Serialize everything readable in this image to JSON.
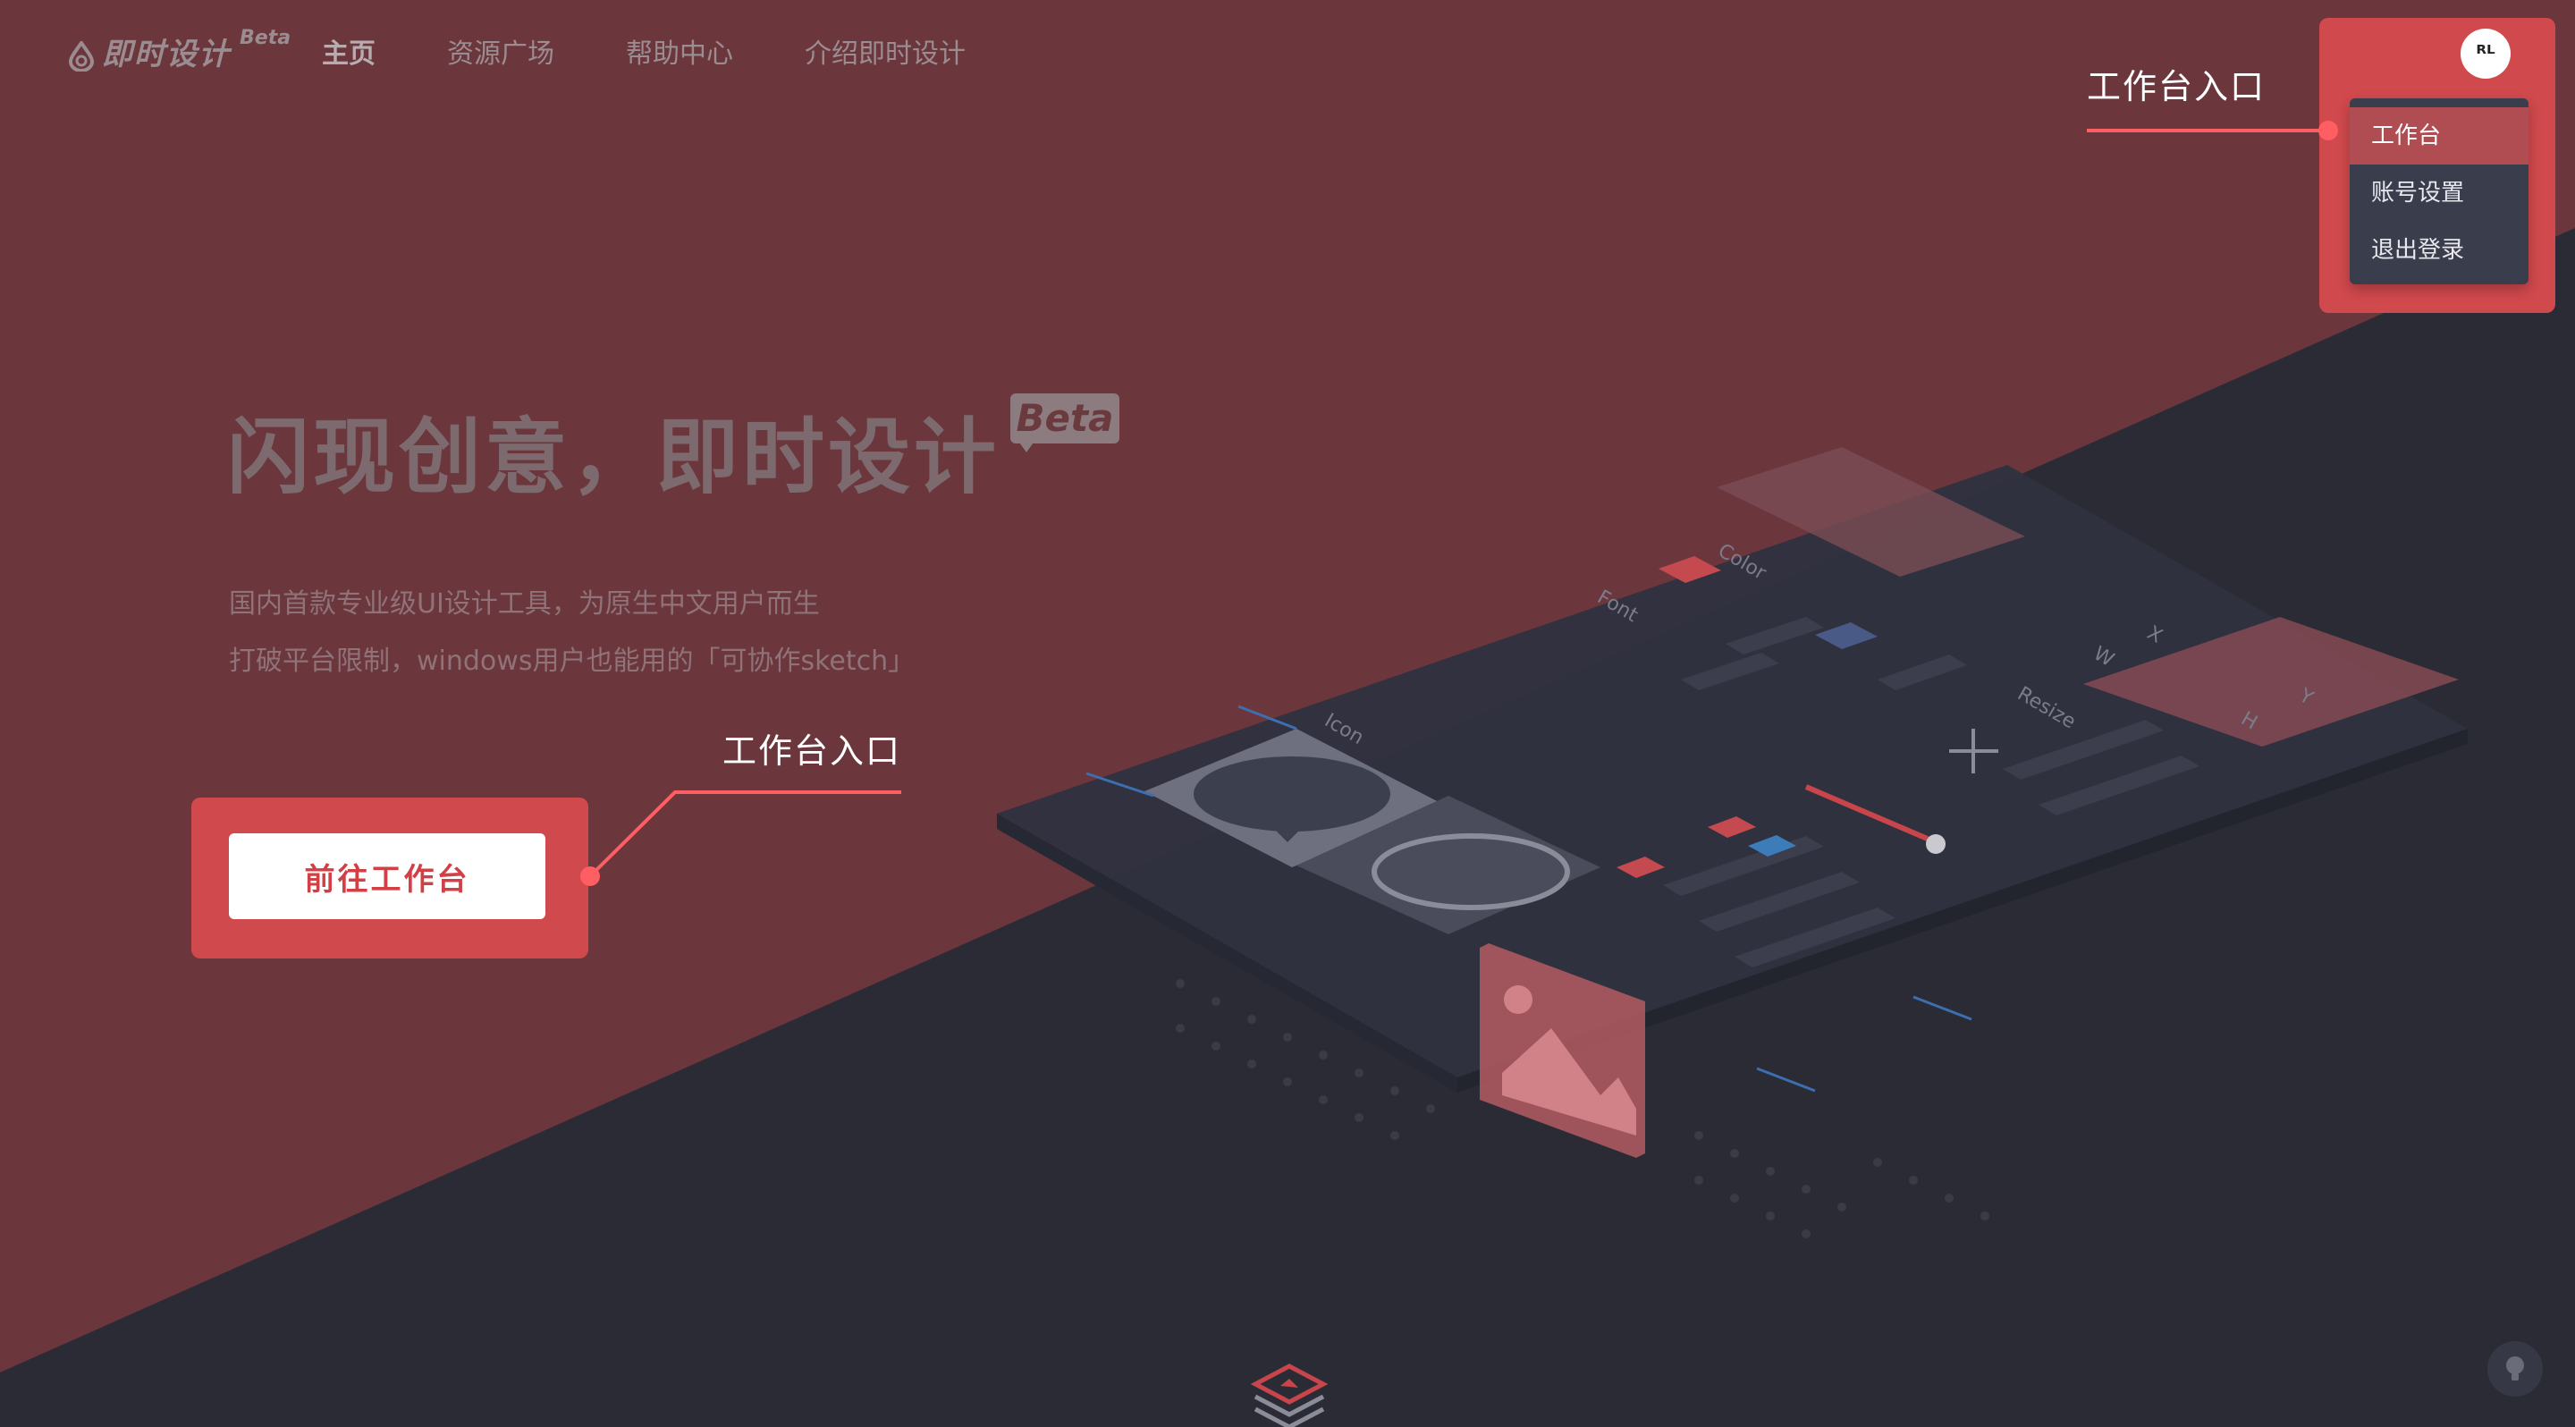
{
  "header": {
    "logo_text": "即时设计",
    "logo_badge": "Beta",
    "nav": [
      {
        "label": "主页",
        "active": true
      },
      {
        "label": "资源广场",
        "active": false
      },
      {
        "label": "帮助中心",
        "active": false
      },
      {
        "label": "介绍即时设计",
        "active": false
      }
    ]
  },
  "user_menu": {
    "avatar_text": "ᴿᴸ",
    "items": [
      "工作台",
      "账号设置",
      "退出登录"
    ]
  },
  "hero": {
    "title": "闪现创意，即时设计",
    "beta_badge": "Beta",
    "subtitle_line1": "国内首款专业级UI设计工具，为原生中文用户而生",
    "subtitle_line2": "打破平台限制，windows用户也能用的「可协作sketch」",
    "cta_label": "前往工作台"
  },
  "annotations": {
    "cta_callout": "工作台入口",
    "menu_callout": "工作台入口"
  },
  "illustration": {
    "panel_labels": [
      "Color",
      "Font",
      "Icon",
      "Resize",
      "X",
      "W",
      "Y",
      "H"
    ]
  },
  "colors": {
    "overlay_red": "#6b363c",
    "highlight_red": "#d0494d",
    "dark_bg": "#2a2b35",
    "menu_bg": "#3a3d4b",
    "callout_line": "#ff5f63"
  }
}
